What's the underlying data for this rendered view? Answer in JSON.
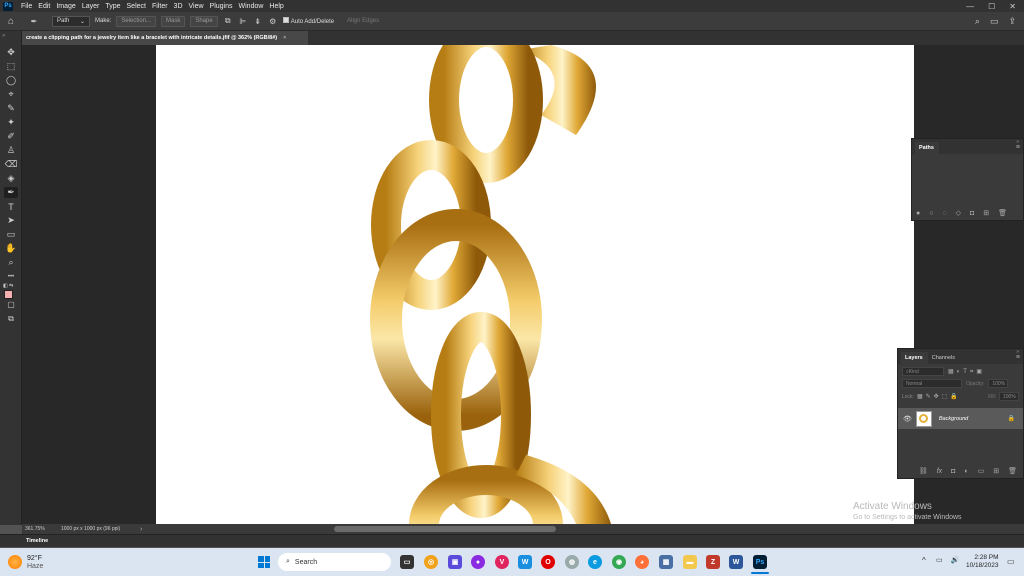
{
  "app": {
    "logo": "Ps"
  },
  "menu": [
    "File",
    "Edit",
    "Image",
    "Layer",
    "Type",
    "Select",
    "Filter",
    "3D",
    "View",
    "Plugins",
    "Window",
    "Help"
  ],
  "window_controls": {
    "minimize": "—",
    "maximize": "☐",
    "close": "✕"
  },
  "options_bar": {
    "home_icon": "⌂",
    "pen_icon": "✒",
    "mode_value": "Path",
    "make_label": "Make:",
    "selection_btn": "Selection...",
    "mask_btn": "Mask",
    "shape_btn": "Shape",
    "gear_icon": "⚙",
    "auto_add_delete": "Auto Add/Delete",
    "align_edges": "Align Edges",
    "search_icon": "⌕",
    "workspace_icon": "▭",
    "share_icon": "⇪"
  },
  "document_tab": {
    "title": "create a clipping path for a jewelry item like a bracelet with intricate details.jfif @ 362% (RGB/8#)",
    "close": "×"
  },
  "tools": [
    "✥",
    "⬚",
    "◯",
    "⌖",
    "✎",
    "✦",
    "✐",
    "♙",
    "⌫",
    "◈",
    "✒",
    "T",
    "➤",
    "▭",
    "✋",
    "⌕",
    "•••"
  ],
  "status_bar": {
    "zoom": "361.75%",
    "doc_info": "1000 px x 1000 px (96 ppi)",
    "arrow": "›"
  },
  "paths_panel": {
    "tab": "Paths",
    "menu": "≡",
    "collapse": "»",
    "footer_icons": [
      "●",
      "○",
      "◌",
      "◇",
      "◘",
      "⊞",
      "🗑"
    ]
  },
  "layers_panel": {
    "tabs": [
      "Layers",
      "Channels"
    ],
    "menu": "≡",
    "collapse": "»",
    "kind_placeholder": "Kind",
    "blend_mode": "Normal",
    "opacity_label": "Opacity:",
    "opacity_value": "100%",
    "lock_label": "Lock:",
    "fill_label": "Fill:",
    "fill_value": "100%",
    "layer_name": "Background",
    "footer_icons": [
      "⛓",
      "fx",
      "◘",
      "◐",
      "▭",
      "⊞",
      "🗑"
    ]
  },
  "timeline": {
    "label": "Timeline"
  },
  "activate_windows": {
    "title": "Activate Windows",
    "subtitle": "Go to Settings to activate Windows"
  },
  "taskbar": {
    "weather_temp": "92°F",
    "weather_desc": "Haze",
    "search_placeholder": "Search",
    "time": "2:28 PM",
    "date": "10/18/2023",
    "tray_up": "^"
  },
  "colors": {
    "accent": "#31a8ff",
    "gold": "#e3b03a",
    "fg_swatch": "#f4b0b0"
  }
}
